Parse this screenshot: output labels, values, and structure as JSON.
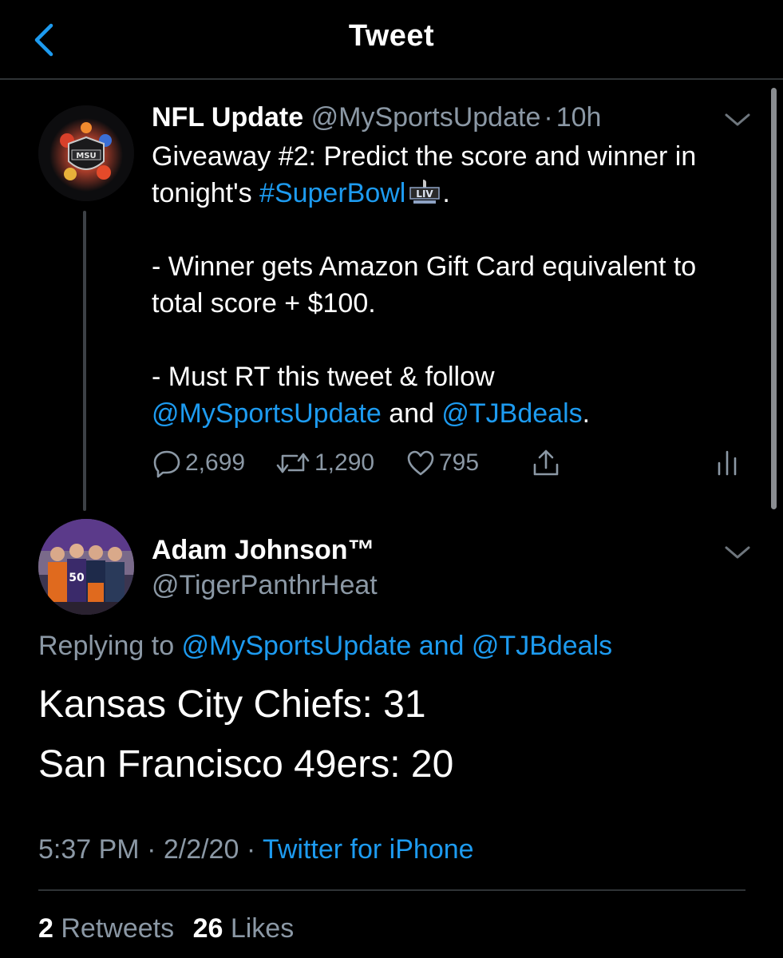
{
  "header": {
    "title": "Tweet",
    "back_icon": "chevron-left-icon"
  },
  "colors": {
    "accent": "#1d9bf0",
    "muted": "#8b98a5",
    "background": "#000000"
  },
  "parent_tweet": {
    "name": "NFL Update",
    "handle": "@MySportsUpdate",
    "separator": "·",
    "time": "10h",
    "avatar_text": "MSU",
    "line1": "Giveaway #2: Predict the score and winner in",
    "line2_prefix": "tonight's ",
    "hashtag": "#SuperBowl",
    "line2_suffix": ".",
    "line3": "- Winner gets Amazon Gift Card equivalent to",
    "line4": "total score + $100.",
    "line5": "- Must RT this tweet & follow",
    "mention1": "@MySportsUpdate",
    "and_word": " and ",
    "mention2": "@TJBdeals",
    "end_period": ".",
    "actions": {
      "replies": "2,699",
      "retweets": "1,290",
      "likes": "795"
    }
  },
  "reply_tweet": {
    "name": "Adam Johnson™",
    "handle": "@TigerPanthrHeat",
    "replying_to_prefix": "Replying to ",
    "replying_to_mentions": "@MySportsUpdate and @TJBdeals",
    "text_line1": "Kansas City Chiefs: 31",
    "text_line2": "San Francisco 49ers: 20",
    "time": "5:37 PM",
    "date": "2/2/20",
    "sep": " · ",
    "source": "Twitter for iPhone",
    "retweets_count": "2",
    "retweets_label": "Retweets",
    "likes_count": "26",
    "likes_label": "Likes"
  }
}
